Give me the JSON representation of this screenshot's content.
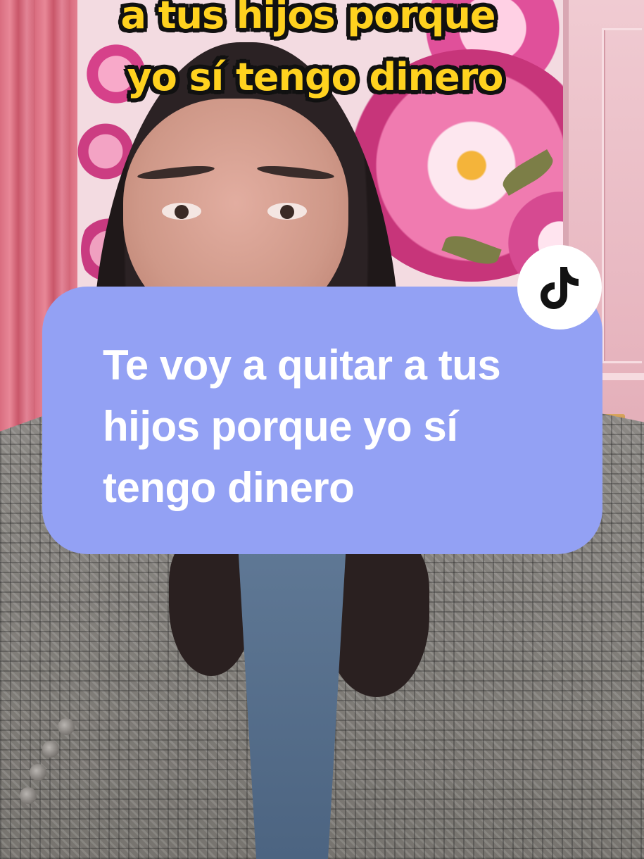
{
  "video": {
    "caption_lines": [
      "a tus hijos porque",
      "yo sí tengo dinero"
    ],
    "quote_card": {
      "text": "Te voy a quitar a tus hijos porque yo sí tengo dinero",
      "background_color": "#93a1f4",
      "text_color": "#ffffff"
    },
    "caption_color": "#ffd21f",
    "badge": {
      "icon": "tiktok-logo-icon"
    }
  }
}
